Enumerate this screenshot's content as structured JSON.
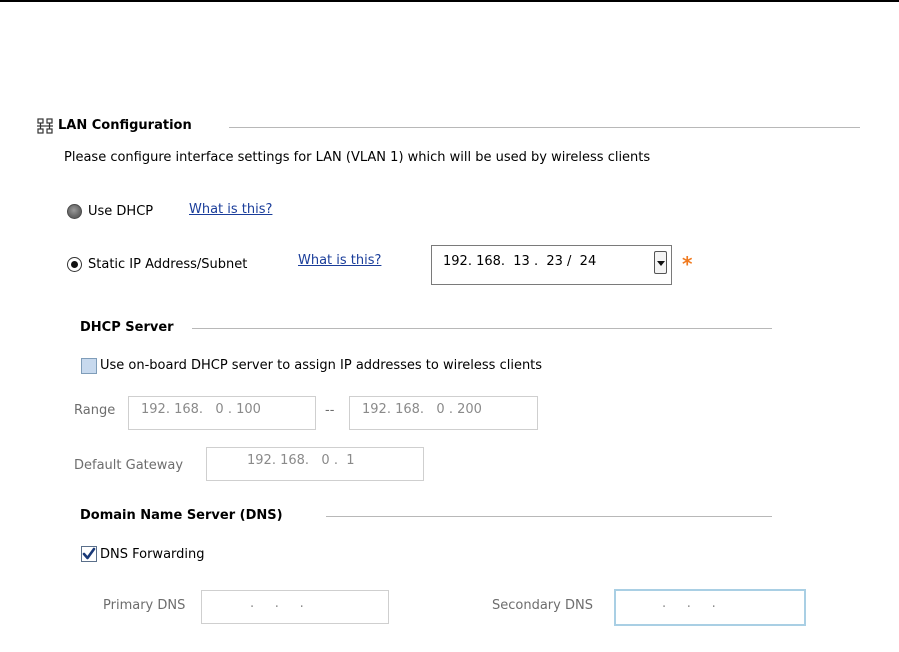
{
  "lan": {
    "title": "LAN Configuration",
    "description": "Please configure interface settings for LAN (VLAN 1) which will be used by wireless clients",
    "use_dhcp_label": "Use DHCP",
    "use_dhcp_help": "What is this?",
    "static_label": "Static IP Address/Subnet",
    "static_help": "What is this?",
    "static_value": "192. 168.  13 .  23 /  24",
    "required_mark": "*"
  },
  "dhcp_server": {
    "title": "DHCP Server",
    "enable_label": "Use on-board DHCP server to assign IP addresses to wireless clients",
    "enabled": false,
    "range_label": "Range",
    "range_start": "192. 168.   0 . 100",
    "range_sep": "--",
    "range_end": "192. 168.   0 . 200",
    "gateway_label": "Default Gateway",
    "gateway_value": "192. 168.   0 .  1"
  },
  "dns": {
    "title": "Domain Name Server (DNS)",
    "forwarding_label": "DNS Forwarding",
    "forwarding_enabled": true,
    "primary_label": "Primary DNS",
    "primary_value": ".     .     .",
    "secondary_label": "Secondary DNS",
    "secondary_value": ".     .     ."
  },
  "colors": {
    "link": "#1a3d9a",
    "required": "#f07a1f",
    "focus_border": "#a9cfe4",
    "rule": "#b8b8b8"
  }
}
